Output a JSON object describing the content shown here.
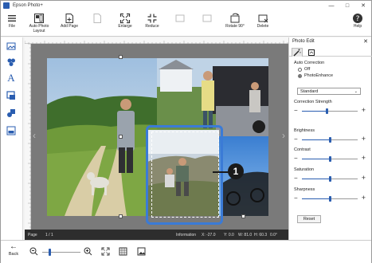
{
  "window": {
    "title": "Epson Photo+"
  },
  "toolbar": {
    "file": "File",
    "auto_photo_layout": "Auto Photo Layout",
    "add_page": "Add Page",
    "delete_page": "",
    "enlarge": "Enlarge",
    "reduce": "Reduce",
    "rotate_left": "",
    "rotate_90": "Rotate 90°",
    "delete": "Delete",
    "help": "Help"
  },
  "status": {
    "page_label": "Page",
    "page_value": "1 / 1",
    "info_label": "Information",
    "x": "X: -27.0",
    "y": "Y: 0.0",
    "w": "W: 81.0",
    "h": "H: 60.3",
    "deg": "0.0°"
  },
  "panel": {
    "title": "Photo Edit",
    "auto_correction": "Auto Correction",
    "off": "Off",
    "photo_enhance": "PhotoEnhance",
    "mode_value": "Standard",
    "correction_strength": "Correction Strength",
    "brightness": "Brightness",
    "contrast": "Contrast",
    "saturation": "Saturation",
    "sharpness": "Sharpness",
    "reset": "Reset"
  },
  "sliders": {
    "correction_strength": 0.45,
    "brightness": 0.5,
    "contrast": 0.5,
    "saturation": 0.5,
    "sharpness": 0.5
  },
  "zoom": {
    "level": 0.2
  },
  "callout": {
    "number": "1"
  },
  "bottom": {
    "back": "Back"
  },
  "colors": {
    "accent": "#2a5db0",
    "selection": "#3b7bd6",
    "canvas": "#7a7a7a",
    "statusbar": "#2d2d2d"
  }
}
